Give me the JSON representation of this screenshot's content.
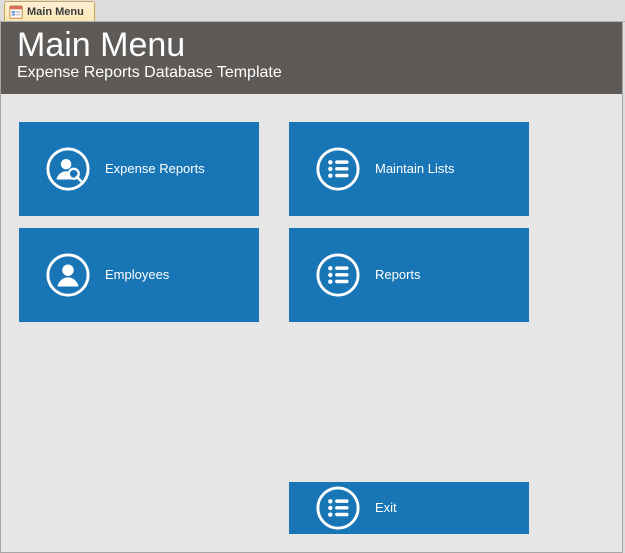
{
  "tab": {
    "label": "Main Menu"
  },
  "header": {
    "title": "Main Menu",
    "subtitle": "Expense Reports  Database Template"
  },
  "tiles": {
    "expense_reports": {
      "label": "Expense Reports",
      "icon": "person-search-icon"
    },
    "maintain_lists": {
      "label": "Maintain Lists",
      "icon": "list-icon"
    },
    "employees": {
      "label": "Employees",
      "icon": "person-icon"
    },
    "reports": {
      "label": "Reports",
      "icon": "list-icon"
    },
    "exit": {
      "label": "Exit",
      "icon": "list-icon"
    }
  },
  "colors": {
    "tile_bg": "#1976b6",
    "header_bg": "#5d5a57",
    "page_bg": "#e6e6e6"
  }
}
